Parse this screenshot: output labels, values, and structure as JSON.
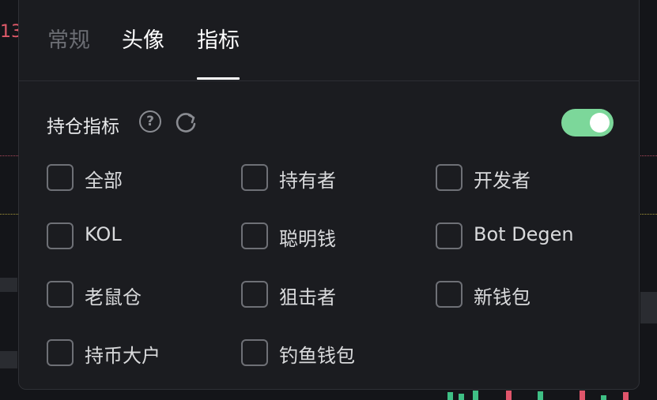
{
  "background": {
    "price_fragment": "13"
  },
  "tabs": [
    {
      "label": "常规",
      "active": false
    },
    {
      "label": "头像",
      "active": false
    },
    {
      "label": "指标",
      "active": true
    }
  ],
  "section": {
    "title": "持仓指标",
    "toggle_on": true
  },
  "options": [
    {
      "label": "全部",
      "checked": false
    },
    {
      "label": "持有者",
      "checked": false
    },
    {
      "label": "开发者",
      "checked": false
    },
    {
      "label": "KOL",
      "checked": false
    },
    {
      "label": "聪明钱",
      "checked": false
    },
    {
      "label": "Bot Degen",
      "checked": false
    },
    {
      "label": "老鼠仓",
      "checked": false
    },
    {
      "label": "狙击者",
      "checked": false
    },
    {
      "label": "新钱包",
      "checked": false
    },
    {
      "label": "持币大户",
      "checked": false
    },
    {
      "label": "钓鱼钱包",
      "checked": false
    }
  ],
  "colors": {
    "toggle_on": "#7cd79a",
    "panel_bg": "#1b1c20",
    "active_tab": "#ffffff",
    "inactive_tab": "#6b6d73"
  }
}
